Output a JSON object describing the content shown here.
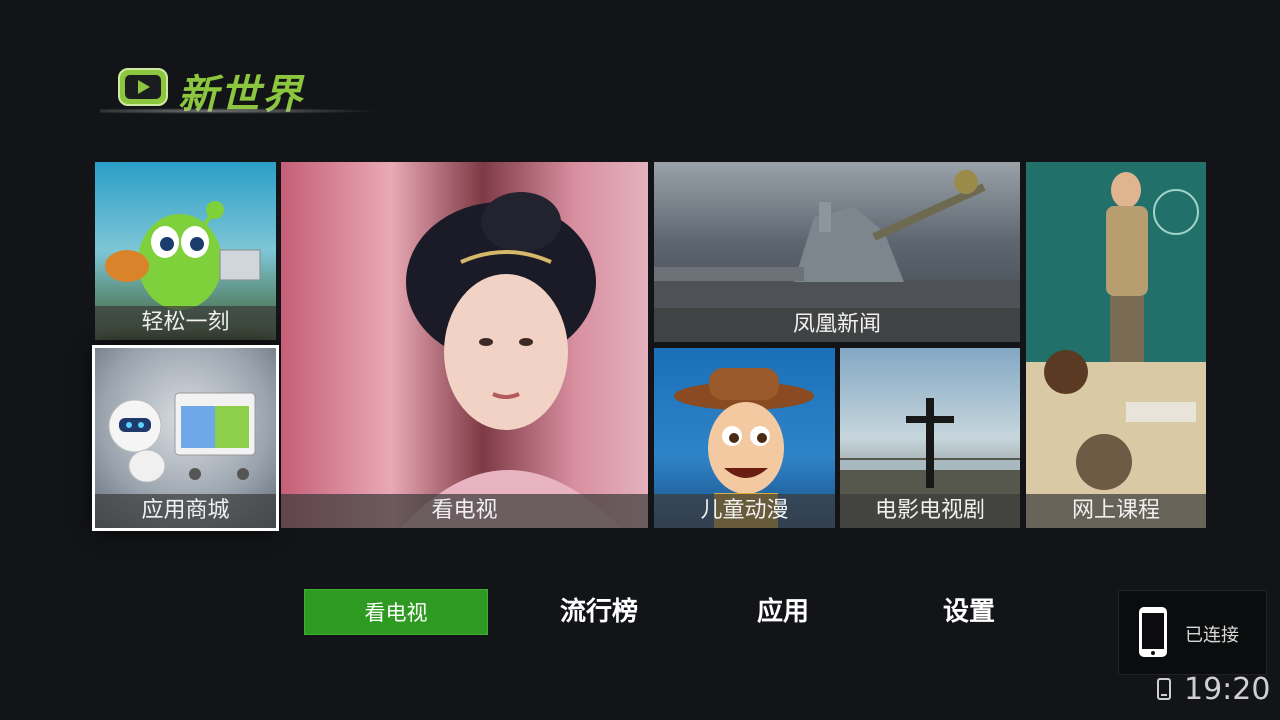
{
  "app": {
    "logo_text": "新世界"
  },
  "tiles": {
    "relax": {
      "label": "轻松一刻"
    },
    "store": {
      "label": "应用商城"
    },
    "tv": {
      "label": "看电视"
    },
    "news": {
      "label": "凤凰新闻"
    },
    "kids": {
      "label": "儿童动漫"
    },
    "movies": {
      "label": "电影电视剧"
    },
    "courses": {
      "label": "网上课程"
    }
  },
  "nav": {
    "items": [
      {
        "label": "看电视",
        "active": true
      },
      {
        "label": "流行榜",
        "active": false
      },
      {
        "label": "应用",
        "active": false
      },
      {
        "label": "设置",
        "active": false
      }
    ]
  },
  "connection": {
    "status": "已连接"
  },
  "status_bar": {
    "time": "19:20"
  },
  "colors": {
    "accent": "#8cc63f",
    "nav_active": "#2e9a22",
    "background": "#121417"
  },
  "icons": [
    "tv-logo-icon",
    "phone-icon"
  ]
}
